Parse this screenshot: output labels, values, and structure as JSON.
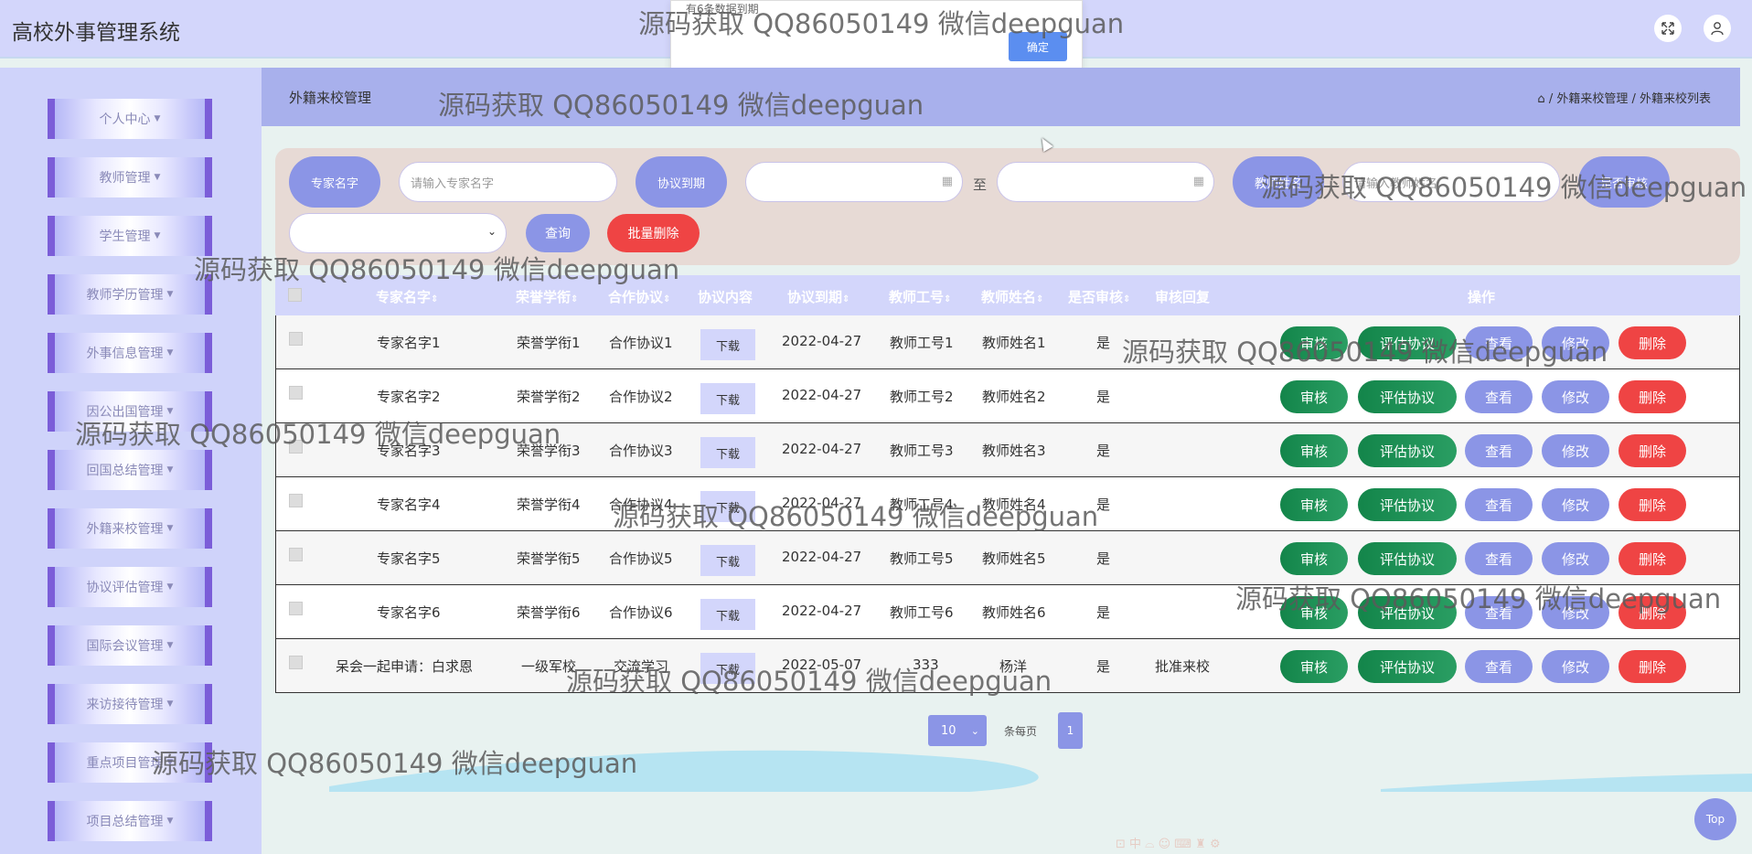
{
  "header": {
    "title": "高校外事管理系统",
    "fullscreen_icon": "expand-icon",
    "user_icon": "user-icon"
  },
  "alert": {
    "message": "有6条数据到期",
    "ok_label": "确定"
  },
  "sidebar": {
    "items": [
      {
        "label": "个人中心"
      },
      {
        "label": "教师管理"
      },
      {
        "label": "学生管理"
      },
      {
        "label": "教师学历管理"
      },
      {
        "label": "外事信息管理"
      },
      {
        "label": "因公出国管理"
      },
      {
        "label": "回国总结管理"
      },
      {
        "label": "外籍来校管理"
      },
      {
        "label": "协议评估管理"
      },
      {
        "label": "国际会议管理"
      },
      {
        "label": "来访接待管理"
      },
      {
        "label": "重点项目管理"
      },
      {
        "label": "项目总结管理"
      }
    ]
  },
  "page": {
    "title": "外籍来校管理",
    "breadcrumb": "/ 外籍来校管理 / 外籍来校列表"
  },
  "search": {
    "expert_label": "专家名字",
    "expert_placeholder": "请输入专家名字",
    "expire_label": "协议到期",
    "to_label": "至",
    "teacher_label": "教师姓名",
    "teacher_placeholder": "请输入教师姓名",
    "review_label": "是否审核",
    "query_label": "查询",
    "batch_delete_label": "批量删除"
  },
  "table": {
    "columns": [
      "专家名字",
      "荣誉学衔",
      "合作协议",
      "协议内容",
      "协议到期",
      "教师工号",
      "教师姓名",
      "是否审核",
      "审核回复",
      "操作"
    ],
    "rows": [
      {
        "name": "专家名字1",
        "title": "荣誉学衔1",
        "agreement": "合作协议1",
        "download": "下载",
        "expire": "2022-04-27",
        "teacher_id": "教师工号1",
        "teacher_name": "教师姓名1",
        "reviewed": "是",
        "reply": ""
      },
      {
        "name": "专家名字2",
        "title": "荣誉学衔2",
        "agreement": "合作协议2",
        "download": "下载",
        "expire": "2022-04-27",
        "teacher_id": "教师工号2",
        "teacher_name": "教师姓名2",
        "reviewed": "是",
        "reply": ""
      },
      {
        "name": "专家名字3",
        "title": "荣誉学衔3",
        "agreement": "合作协议3",
        "download": "下载",
        "expire": "2022-04-27",
        "teacher_id": "教师工号3",
        "teacher_name": "教师姓名3",
        "reviewed": "是",
        "reply": ""
      },
      {
        "name": "专家名字4",
        "title": "荣誉学衔4",
        "agreement": "合作协议4",
        "download": "下载",
        "expire": "2022-04-27",
        "teacher_id": "教师工号4",
        "teacher_name": "教师姓名4",
        "reviewed": "是",
        "reply": ""
      },
      {
        "name": "专家名字5",
        "title": "荣誉学衔5",
        "agreement": "合作协议5",
        "download": "下载",
        "expire": "2022-04-27",
        "teacher_id": "教师工号5",
        "teacher_name": "教师姓名5",
        "reviewed": "是",
        "reply": ""
      },
      {
        "name": "专家名字6",
        "title": "荣誉学衔6",
        "agreement": "合作协议6",
        "download": "下载",
        "expire": "2022-04-27",
        "teacher_id": "教师工号6",
        "teacher_name": "教师姓名6",
        "reviewed": "是",
        "reply": ""
      },
      {
        "name": "呆会一起申请：白求恩",
        "title": "一级军校",
        "agreement": "交流学习",
        "download": "下载",
        "expire": "2022-05-07",
        "teacher_id": "333",
        "teacher_name": "杨洋",
        "reviewed": "是",
        "reply": "批准来校"
      }
    ],
    "actions": {
      "review": "审核",
      "evaluate": "评估协议",
      "view": "查看",
      "edit": "修改",
      "delete": "删除"
    }
  },
  "pagination": {
    "page_size": "10",
    "per_page_label": "条每页",
    "current_page": "1"
  },
  "top_button": "Top",
  "watermark": "源码获取 QQ86050149 微信deepguan"
}
